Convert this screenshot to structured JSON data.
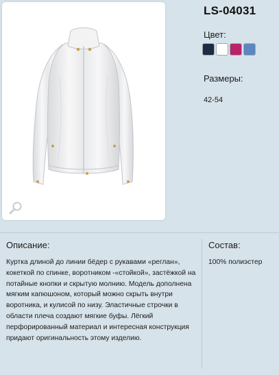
{
  "product": {
    "sku": "LS-04031",
    "color_label": "Цвет:",
    "colors": [
      {
        "name": "navy",
        "hex": "#1f2a44"
      },
      {
        "name": "white",
        "hex": "#ffffff"
      },
      {
        "name": "magenta",
        "hex": "#b8236a"
      },
      {
        "name": "blue",
        "hex": "#5d86c0"
      }
    ],
    "sizes_label": "Размеры:",
    "sizes_value": "42-54"
  },
  "photo": {
    "subject": "white-jacket",
    "zoom_icon": "magnifier-icon"
  },
  "description": {
    "title": "Описание:",
    "text": "Куртка длиной до линии бёдер с рукавами «реглан», кокеткой по спинке, воротником -«стойкой», застёжкой на потайные кнопки и скрытую молнию. Модель дополнена мягким капюшоном, который можно скрыть внутри воротника, и кулисой по низу. Эластичные строчки в области плеча создают мягкие буфы. Лёгкий перфорированный материал и интересная конструкция придают оригинальность этому изделию."
  },
  "composition": {
    "title": "Состав:",
    "value": "100% полиэстер"
  }
}
